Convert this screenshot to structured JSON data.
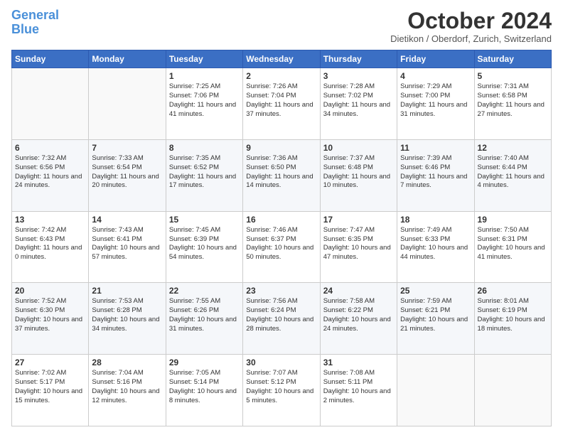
{
  "header": {
    "logo_line1": "General",
    "logo_line2": "Blue",
    "month": "October 2024",
    "location": "Dietikon / Oberdorf, Zurich, Switzerland"
  },
  "weekdays": [
    "Sunday",
    "Monday",
    "Tuesday",
    "Wednesday",
    "Thursday",
    "Friday",
    "Saturday"
  ],
  "weeks": [
    [
      {
        "day": "",
        "info": ""
      },
      {
        "day": "",
        "info": ""
      },
      {
        "day": "1",
        "info": "Sunrise: 7:25 AM\nSunset: 7:06 PM\nDaylight: 11 hours and 41 minutes."
      },
      {
        "day": "2",
        "info": "Sunrise: 7:26 AM\nSunset: 7:04 PM\nDaylight: 11 hours and 37 minutes."
      },
      {
        "day": "3",
        "info": "Sunrise: 7:28 AM\nSunset: 7:02 PM\nDaylight: 11 hours and 34 minutes."
      },
      {
        "day": "4",
        "info": "Sunrise: 7:29 AM\nSunset: 7:00 PM\nDaylight: 11 hours and 31 minutes."
      },
      {
        "day": "5",
        "info": "Sunrise: 7:31 AM\nSunset: 6:58 PM\nDaylight: 11 hours and 27 minutes."
      }
    ],
    [
      {
        "day": "6",
        "info": "Sunrise: 7:32 AM\nSunset: 6:56 PM\nDaylight: 11 hours and 24 minutes."
      },
      {
        "day": "7",
        "info": "Sunrise: 7:33 AM\nSunset: 6:54 PM\nDaylight: 11 hours and 20 minutes."
      },
      {
        "day": "8",
        "info": "Sunrise: 7:35 AM\nSunset: 6:52 PM\nDaylight: 11 hours and 17 minutes."
      },
      {
        "day": "9",
        "info": "Sunrise: 7:36 AM\nSunset: 6:50 PM\nDaylight: 11 hours and 14 minutes."
      },
      {
        "day": "10",
        "info": "Sunrise: 7:37 AM\nSunset: 6:48 PM\nDaylight: 11 hours and 10 minutes."
      },
      {
        "day": "11",
        "info": "Sunrise: 7:39 AM\nSunset: 6:46 PM\nDaylight: 11 hours and 7 minutes."
      },
      {
        "day": "12",
        "info": "Sunrise: 7:40 AM\nSunset: 6:44 PM\nDaylight: 11 hours and 4 minutes."
      }
    ],
    [
      {
        "day": "13",
        "info": "Sunrise: 7:42 AM\nSunset: 6:43 PM\nDaylight: 11 hours and 0 minutes."
      },
      {
        "day": "14",
        "info": "Sunrise: 7:43 AM\nSunset: 6:41 PM\nDaylight: 10 hours and 57 minutes."
      },
      {
        "day": "15",
        "info": "Sunrise: 7:45 AM\nSunset: 6:39 PM\nDaylight: 10 hours and 54 minutes."
      },
      {
        "day": "16",
        "info": "Sunrise: 7:46 AM\nSunset: 6:37 PM\nDaylight: 10 hours and 50 minutes."
      },
      {
        "day": "17",
        "info": "Sunrise: 7:47 AM\nSunset: 6:35 PM\nDaylight: 10 hours and 47 minutes."
      },
      {
        "day": "18",
        "info": "Sunrise: 7:49 AM\nSunset: 6:33 PM\nDaylight: 10 hours and 44 minutes."
      },
      {
        "day": "19",
        "info": "Sunrise: 7:50 AM\nSunset: 6:31 PM\nDaylight: 10 hours and 41 minutes."
      }
    ],
    [
      {
        "day": "20",
        "info": "Sunrise: 7:52 AM\nSunset: 6:30 PM\nDaylight: 10 hours and 37 minutes."
      },
      {
        "day": "21",
        "info": "Sunrise: 7:53 AM\nSunset: 6:28 PM\nDaylight: 10 hours and 34 minutes."
      },
      {
        "day": "22",
        "info": "Sunrise: 7:55 AM\nSunset: 6:26 PM\nDaylight: 10 hours and 31 minutes."
      },
      {
        "day": "23",
        "info": "Sunrise: 7:56 AM\nSunset: 6:24 PM\nDaylight: 10 hours and 28 minutes."
      },
      {
        "day": "24",
        "info": "Sunrise: 7:58 AM\nSunset: 6:22 PM\nDaylight: 10 hours and 24 minutes."
      },
      {
        "day": "25",
        "info": "Sunrise: 7:59 AM\nSunset: 6:21 PM\nDaylight: 10 hours and 21 minutes."
      },
      {
        "day": "26",
        "info": "Sunrise: 8:01 AM\nSunset: 6:19 PM\nDaylight: 10 hours and 18 minutes."
      }
    ],
    [
      {
        "day": "27",
        "info": "Sunrise: 7:02 AM\nSunset: 5:17 PM\nDaylight: 10 hours and 15 minutes."
      },
      {
        "day": "28",
        "info": "Sunrise: 7:04 AM\nSunset: 5:16 PM\nDaylight: 10 hours and 12 minutes."
      },
      {
        "day": "29",
        "info": "Sunrise: 7:05 AM\nSunset: 5:14 PM\nDaylight: 10 hours and 8 minutes."
      },
      {
        "day": "30",
        "info": "Sunrise: 7:07 AM\nSunset: 5:12 PM\nDaylight: 10 hours and 5 minutes."
      },
      {
        "day": "31",
        "info": "Sunrise: 7:08 AM\nSunset: 5:11 PM\nDaylight: 10 hours and 2 minutes."
      },
      {
        "day": "",
        "info": ""
      },
      {
        "day": "",
        "info": ""
      }
    ]
  ]
}
